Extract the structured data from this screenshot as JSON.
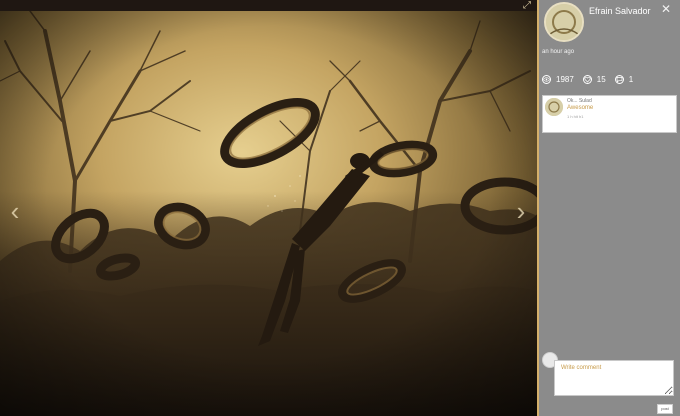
{
  "viewer": {
    "expand_icon": "expand-icon",
    "prev_icon": "chevron-left-icon",
    "next_icon": "chevron-right-icon",
    "prev_glyph": "‹",
    "next_glyph": "›",
    "expand_glyph": "⤢"
  },
  "panel": {
    "author": "Efrain Salvador",
    "close_glyph": "✕",
    "time": "an hour ago",
    "stats": [
      {
        "icon": "eye-icon",
        "value": "1987"
      },
      {
        "icon": "heart-icon",
        "value": "15"
      },
      {
        "icon": "comment-icon",
        "value": "1"
      }
    ],
    "comments": [
      {
        "name": "Ok... Sulad",
        "text": "Awesome",
        "time": "1 h hit h1"
      }
    ],
    "write_placeholder": "Write comment",
    "post_label": "post"
  },
  "colors": {
    "panel_bg": "#8b8b8b",
    "accent": "#c79b4a",
    "border_accent": "#d5b06b"
  }
}
